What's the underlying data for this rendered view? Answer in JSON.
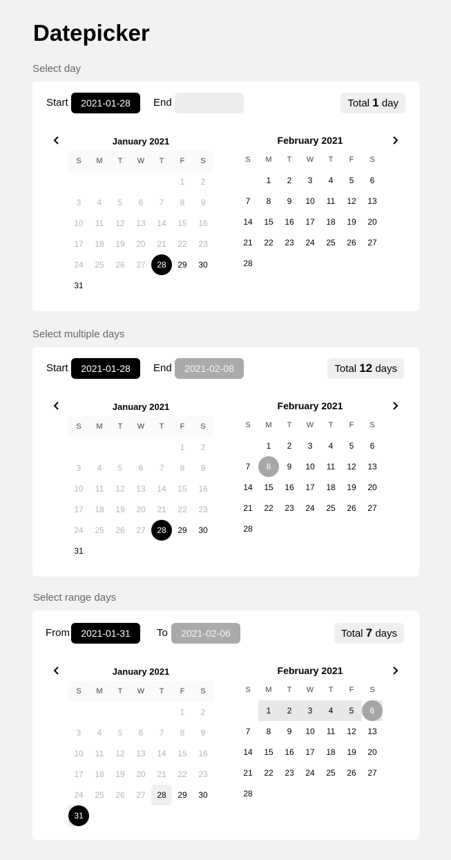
{
  "page": {
    "title": "Datepicker"
  },
  "weekdays": [
    "S",
    "M",
    "T",
    "W",
    "T",
    "F",
    "S"
  ],
  "jan_days": [
    {
      "d": "",
      "c": "e"
    },
    {
      "d": "",
      "c": "e"
    },
    {
      "d": "",
      "c": "e"
    },
    {
      "d": "",
      "c": "e"
    },
    {
      "d": "",
      "c": "e"
    },
    {
      "d": "1",
      "c": "dis"
    },
    {
      "d": "2",
      "c": "dis"
    },
    {
      "d": "3",
      "c": "dis"
    },
    {
      "d": "4",
      "c": "dis"
    },
    {
      "d": "5",
      "c": "dis"
    },
    {
      "d": "6",
      "c": "dis"
    },
    {
      "d": "7",
      "c": "dis"
    },
    {
      "d": "8",
      "c": "dis"
    },
    {
      "d": "9",
      "c": "dis"
    },
    {
      "d": "10",
      "c": "dis"
    },
    {
      "d": "11",
      "c": "dis"
    },
    {
      "d": "12",
      "c": "dis"
    },
    {
      "d": "13",
      "c": "dis"
    },
    {
      "d": "14",
      "c": "dis"
    },
    {
      "d": "15",
      "c": "dis"
    },
    {
      "d": "16",
      "c": "dis"
    },
    {
      "d": "17",
      "c": "dis"
    },
    {
      "d": "18",
      "c": "dis"
    },
    {
      "d": "19",
      "c": "dis"
    },
    {
      "d": "20",
      "c": "dis"
    },
    {
      "d": "21",
      "c": "dis"
    },
    {
      "d": "22",
      "c": "dis"
    },
    {
      "d": "23",
      "c": "dis"
    },
    {
      "d": "24",
      "c": "dis"
    },
    {
      "d": "25",
      "c": "dis"
    },
    {
      "d": "26",
      "c": "dis"
    },
    {
      "d": "27",
      "c": "dis"
    },
    {
      "d": "28",
      "c": ""
    },
    {
      "d": "29",
      "c": ""
    },
    {
      "d": "30",
      "c": ""
    },
    {
      "d": "31",
      "c": ""
    }
  ],
  "feb_days": [
    {
      "d": "",
      "c": "e"
    },
    {
      "d": "1",
      "c": ""
    },
    {
      "d": "2",
      "c": ""
    },
    {
      "d": "3",
      "c": ""
    },
    {
      "d": "4",
      "c": ""
    },
    {
      "d": "5",
      "c": ""
    },
    {
      "d": "6",
      "c": ""
    },
    {
      "d": "7",
      "c": ""
    },
    {
      "d": "8",
      "c": ""
    },
    {
      "d": "9",
      "c": ""
    },
    {
      "d": "10",
      "c": ""
    },
    {
      "d": "11",
      "c": ""
    },
    {
      "d": "12",
      "c": ""
    },
    {
      "d": "13",
      "c": ""
    },
    {
      "d": "14",
      "c": ""
    },
    {
      "d": "15",
      "c": ""
    },
    {
      "d": "16",
      "c": ""
    },
    {
      "d": "17",
      "c": ""
    },
    {
      "d": "18",
      "c": ""
    },
    {
      "d": "19",
      "c": ""
    },
    {
      "d": "20",
      "c": ""
    },
    {
      "d": "21",
      "c": ""
    },
    {
      "d": "22",
      "c": ""
    },
    {
      "d": "23",
      "c": ""
    },
    {
      "d": "24",
      "c": ""
    },
    {
      "d": "25",
      "c": ""
    },
    {
      "d": "26",
      "c": ""
    },
    {
      "d": "27",
      "c": ""
    },
    {
      "d": "28",
      "c": ""
    }
  ],
  "sections": [
    {
      "label": "Select day",
      "start_label": "Start",
      "start_value": "2021-01-28",
      "end_label": "End",
      "end_value": "",
      "total_prefix": "Total",
      "total_count": "1",
      "total_unit": "day",
      "jan_title": "January 2021",
      "feb_title": "February 2021",
      "selected_jan": "28",
      "selected_feb": ""
    },
    {
      "label": "Select multiple days",
      "start_label": "Start",
      "start_value": "2021-01-28",
      "end_label": "End",
      "end_value": "2021-02-08",
      "total_prefix": "Total",
      "total_count": "12",
      "total_unit": "days",
      "jan_title": "January 2021",
      "feb_title": "February 2021",
      "selected_jan": "28",
      "selected_feb": "8"
    },
    {
      "label": "Select range days",
      "start_label": "From",
      "start_value": "2021-01-31",
      "end_label": "To",
      "end_value": "2021-02-06",
      "total_prefix": "Total",
      "total_count": "7",
      "total_unit": "days",
      "jan_title": "January 2021",
      "feb_title": "February 2021",
      "selected_jan": "31",
      "selected_feb": "6",
      "range_feb": [
        "1",
        "2",
        "3",
        "4",
        "5"
      ],
      "soft_jan": "28"
    }
  ],
  "icons": {
    "prev": "chevron-left-icon",
    "next": "chevron-right-icon"
  },
  "colors": {
    "selected": "#000000",
    "secondary_selected": "#a6a6a6",
    "range": "#e8e8e8",
    "background": "#f2f2f2"
  }
}
